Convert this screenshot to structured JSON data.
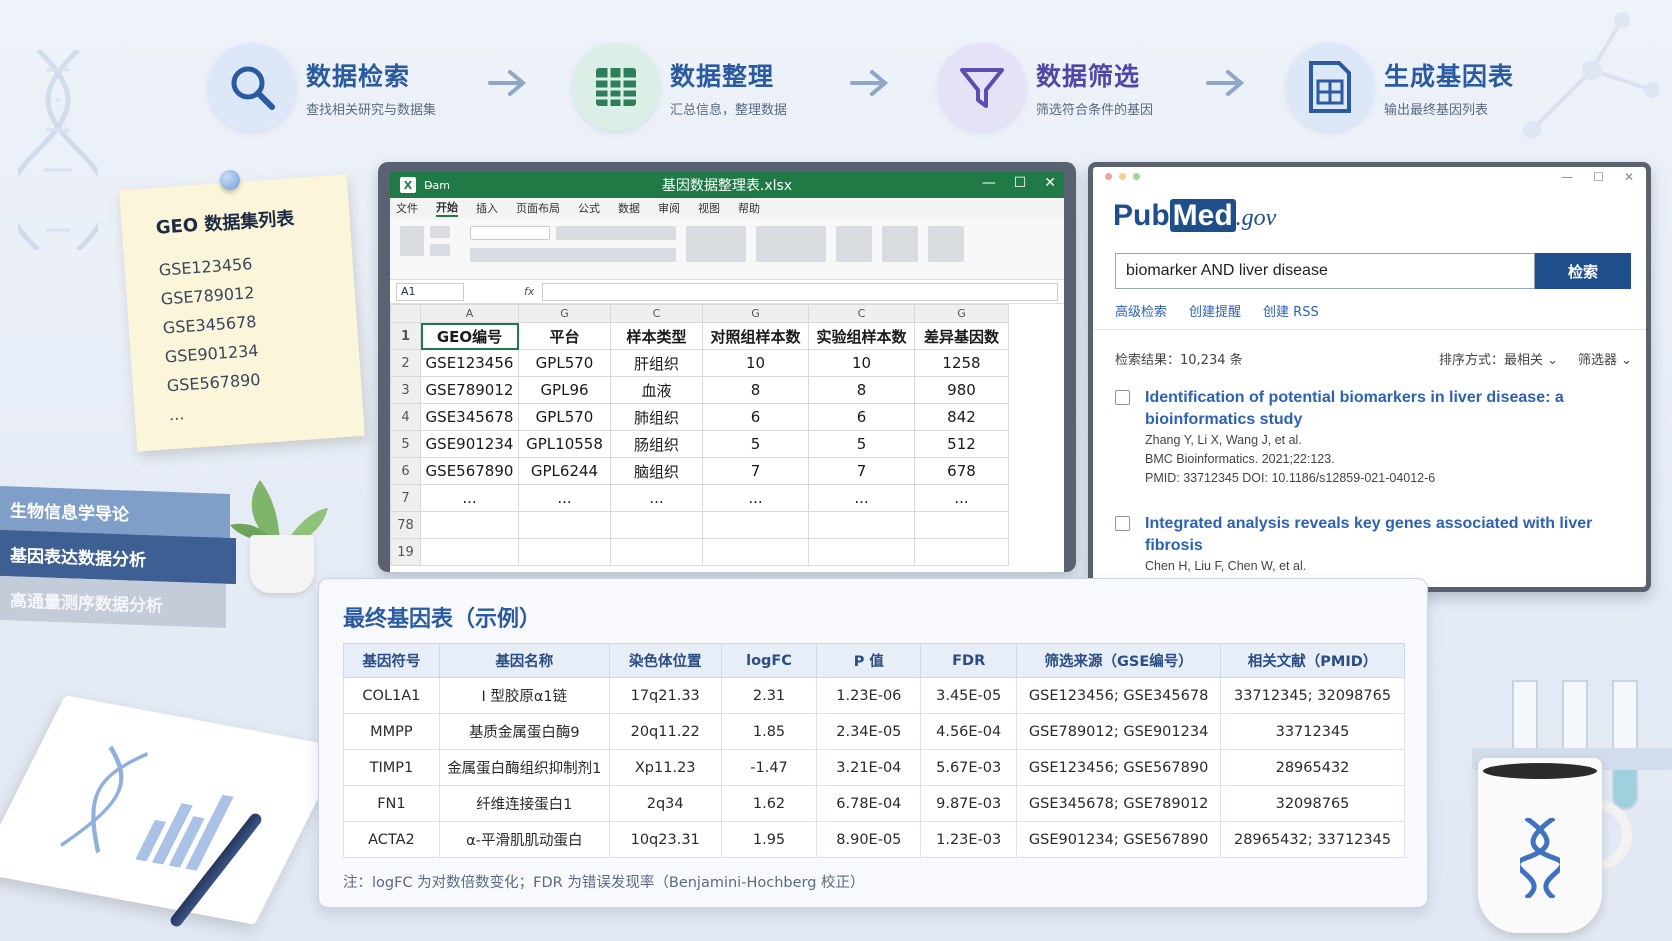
{
  "steps": [
    {
      "title": "数据检索",
      "sub": "查找相关研究与数据集",
      "icon": "search-icon",
      "color": "#dce8f8"
    },
    {
      "title": "数据整理",
      "sub": "汇总信息，整理数据",
      "icon": "table-icon",
      "color": "#dcefe6"
    },
    {
      "title": "数据筛选",
      "sub": "筛选符合条件的基因",
      "icon": "filter-icon",
      "color": "#e4e2f6"
    },
    {
      "title": "生成基因表",
      "sub": "输出最终基因列表",
      "icon": "gene-table-icon",
      "color": "#dce8f8"
    }
  ],
  "note": {
    "title": "GEO 数据集列表",
    "items": [
      "GSE123456",
      "GSE789012",
      "GSE345678",
      "GSE901234",
      "GSE567890",
      "..."
    ]
  },
  "books": [
    "生物信息学导论",
    "基因表达数据分析",
    "高通量测序数据分析"
  ],
  "excel": {
    "app_label": "D̶am",
    "filename": "基因数据整理表.xlsx",
    "menu": [
      "文件",
      "开始",
      "插入",
      "页面布局",
      "公式",
      "数据",
      "审阅",
      "视图",
      "帮助"
    ],
    "active_menu": "开始",
    "cell_ref": "A1",
    "fx": "fx",
    "col_letters": [
      "A",
      "G",
      "C",
      "G",
      "C",
      "G"
    ],
    "headers": [
      "GEO编号",
      "平台",
      "样本类型",
      "对照组样本数",
      "实验组样本数",
      "差异基因数"
    ],
    "rows": [
      {
        "n": "2",
        "cells": [
          "GSE123456",
          "GPL570",
          "肝组织",
          "10",
          "10",
          "1258"
        ]
      },
      {
        "n": "3",
        "cells": [
          "GSE789012",
          "GPL96",
          "血液",
          "8",
          "8",
          "980"
        ]
      },
      {
        "n": "4",
        "cells": [
          "GSE345678",
          "GPL570",
          "肺组织",
          "6",
          "6",
          "842"
        ]
      },
      {
        "n": "5",
        "cells": [
          "GSE901234",
          "GPL10558",
          "肠组织",
          "5",
          "5",
          "512"
        ]
      },
      {
        "n": "6",
        "cells": [
          "GSE567890",
          "GPL6244",
          "脑组织",
          "7",
          "7",
          "678"
        ]
      },
      {
        "n": "7",
        "cells": [
          "...",
          "...",
          "...",
          "...",
          "...",
          "..."
        ]
      },
      {
        "n": "78",
        "cells": [
          "",
          "",
          "",
          "",
          "",
          ""
        ]
      },
      {
        "n": "19",
        "cells": [
          "",
          "",
          "",
          "",
          "",
          ""
        ]
      }
    ],
    "header_row_num": "1"
  },
  "pubmed": {
    "logo_pub": "Pub",
    "logo_med": "Med",
    "logo_gov": ".gov",
    "query": "biomarker AND liver disease",
    "search_button": "检索",
    "links": [
      "高级检索",
      "创建提醒",
      "创建 RSS"
    ],
    "count": "检索结果：10,234 条",
    "sort": "排序方式：最相关 ⌄",
    "filter": "筛选器 ⌄",
    "results": [
      {
        "title": "Identification of potential biomarkers in liver disease: a bioinformatics study",
        "authors": "Zhang Y, Li X, Wang J, et al.",
        "journal": "BMC Bioinformatics. 2021;22:123.",
        "ids": "PMID: 33712345    DOI: 10.1186/s12859-021-04012-6"
      },
      {
        "title": "Integrated analysis reveals key genes associated with liver fibrosis",
        "authors": "Chen H, Liu F, Chen W, et al.",
        "journal": "",
        "ids": ""
      }
    ]
  },
  "final_table": {
    "title": "最终基因表（示例）",
    "columns": [
      "基因符号",
      "基因名称",
      "染色体位置",
      "logFC",
      "P 值",
      "FDR",
      "筛选来源（GSE编号）",
      "相关文献（PMID）"
    ],
    "rows": [
      [
        "COL1A1",
        "I 型胶原α1链",
        "17q21.33",
        "2.31",
        "1.23E-06",
        "3.45E-05",
        "GSE123456; GSE345678",
        "33712345; 32098765"
      ],
      [
        "MMPP",
        "基质金属蛋白酶9",
        "20q11.22",
        "1.85",
        "2.34E-05",
        "4.56E-04",
        "GSE789012; GSE901234",
        "33712345"
      ],
      [
        "TIMP1",
        "金属蛋白酶组织抑制剂1",
        "Xp11.23",
        "-1.47",
        "3.21E-04",
        "5.67E-03",
        "GSE123456; GSE567890",
        "28965432"
      ],
      [
        "FN1",
        "纤维连接蛋白1",
        "2q34",
        "1.62",
        "6.78E-04",
        "9.87E-03",
        "GSE345678; GSE789012",
        "32098765"
      ],
      [
        "ACTA2",
        "α-平滑肌肌动蛋白",
        "10q23.31",
        "1.95",
        "8.90E-05",
        "1.23E-03",
        "GSE901234; GSE567890",
        "28965432; 33712345"
      ]
    ],
    "note": "注：logFC 为对数倍数变化；FDR 为错误发现率（Benjamini-Hochberg 校正）"
  },
  "colors": {
    "accent": "#2a5aa0",
    "excel_green": "#1f7a45",
    "pubmed_blue": "#1f4e8c"
  }
}
